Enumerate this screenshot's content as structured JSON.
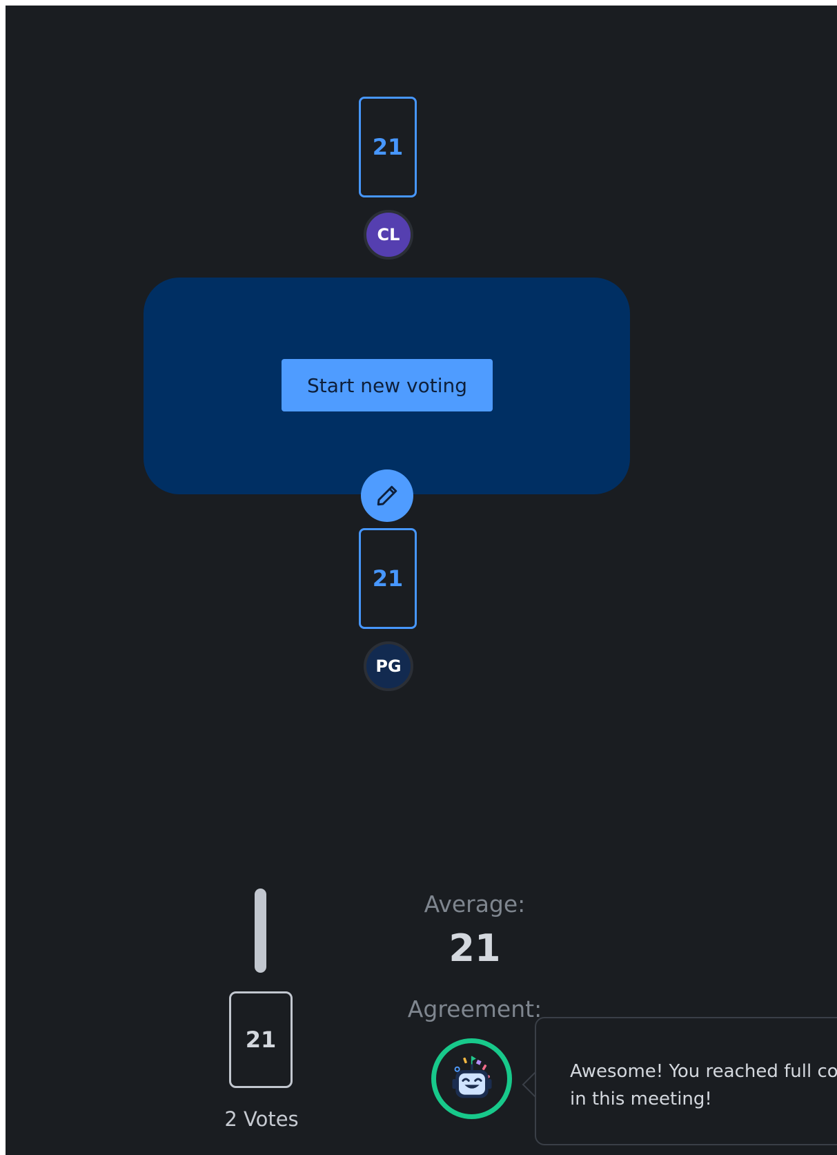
{
  "players": [
    {
      "card_value": "21",
      "initials": "CL",
      "avatar_color": "#553fb0"
    },
    {
      "card_value": "21",
      "initials": "PG",
      "avatar_color": "#122a50"
    }
  ],
  "table": {
    "start_button_label": "Start new voting",
    "edit_icon": "pencil-icon"
  },
  "results": {
    "distribution": [
      {
        "value": "21",
        "votes_label": "2 Votes",
        "share": 1.0
      }
    ],
    "average_label": "Average:",
    "average_value": "21",
    "agreement_label": "Agreement:",
    "agreement_icon": "party-robot-icon",
    "agreement_ring_color": "#18c98b",
    "message_line1": "Awesome! You reached full consensus",
    "message_line2": "in this meeting!"
  },
  "colors": {
    "background": "#1a1d21",
    "table": "#002f63",
    "accent": "#4f9cff",
    "card_border": "#4797ff"
  }
}
